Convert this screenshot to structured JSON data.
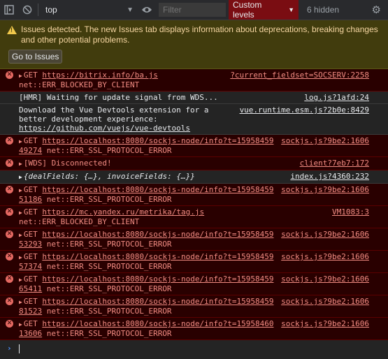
{
  "toolbar": {
    "context": "top",
    "filter_placeholder": "Filter",
    "levels_label": "Custom levels",
    "hidden_count": "6 hidden"
  },
  "warning": {
    "text": "Issues detected. The new Issues tab displays information about deprecations, breaking changes and other potential problems.",
    "button": "Go to Issues"
  },
  "rows": [
    {
      "type": "error",
      "line1": "GET ",
      "url": "https://bitrix.info/ba.js",
      "line2": "net::ERR_BLOCKED_BY_CLIENT",
      "src": "?current_fieldset=SOCSERV:2258"
    },
    {
      "type": "plain",
      "text": "[HMR] Waiting for update signal from WDS...",
      "src": "log.js?1afd:24"
    },
    {
      "type": "plain",
      "text": "Download the Vue Devtools extension for a",
      "text2": "better development experience:",
      "link": "https://github.com/vuejs/vue-devtools",
      "src": "vue.runtime.esm.js?2b0e:8429"
    },
    {
      "type": "error",
      "line1": "GET ",
      "url": "https://localhost:8080/sockjs-node/info?t=15958459",
      "tail": "49274",
      "line2": " net::ERR_SSL_PROTOCOL_ERROR",
      "src": "sockjs.js?9be2:1606"
    },
    {
      "type": "error",
      "text": "[WDS] Disconnected!",
      "src": "client?7eb7:172"
    },
    {
      "type": "plain",
      "text": "{dealFields: {…}, invoiceFields: {…}}",
      "src": "index.js?4360:232"
    },
    {
      "type": "error",
      "line1": "GET ",
      "url": "https://localhost:8080/sockjs-node/info?t=15958459",
      "tail": "51186",
      "line2": " net::ERR_SSL_PROTOCOL_ERROR",
      "src": "sockjs.js?9be2:1606"
    },
    {
      "type": "error",
      "line1": "GET ",
      "url": "https://mc.yandex.ru/metrika/tag.js",
      "line2": "net::ERR_BLOCKED_BY_CLIENT",
      "src": "VM1083:3"
    },
    {
      "type": "error",
      "line1": "GET ",
      "url": "https://localhost:8080/sockjs-node/info?t=15958459",
      "tail": "53293",
      "line2": " net::ERR_SSL_PROTOCOL_ERROR",
      "src": "sockjs.js?9be2:1606"
    },
    {
      "type": "error",
      "line1": "GET ",
      "url": "https://localhost:8080/sockjs-node/info?t=15958459",
      "tail": "57374",
      "line2": " net::ERR_SSL_PROTOCOL_ERROR",
      "src": "sockjs.js?9be2:1606"
    },
    {
      "type": "error",
      "line1": "GET ",
      "url": "https://localhost:8080/sockjs-node/info?t=15958459",
      "tail": "65411",
      "line2": " net::ERR_SSL_PROTOCOL_ERROR",
      "src": "sockjs.js?9be2:1606"
    },
    {
      "type": "error",
      "line1": "GET ",
      "url": "https://localhost:8080/sockjs-node/info?t=15958459",
      "tail": "81523",
      "line2": " net::ERR_SSL_PROTOCOL_ERROR",
      "src": "sockjs.js?9be2:1606"
    },
    {
      "type": "error",
      "line1": "GET ",
      "url": "https://localhost:8080/sockjs-node/info?t=15958460",
      "tail": "13606",
      "line2": " net::ERR_SSL_PROTOCOL_ERROR",
      "src": "sockjs.js?9be2:1606"
    }
  ],
  "colors": {
    "error_bg": "#290000",
    "error_text": "#f28b82",
    "levels_bg": "#7a0d12",
    "warning_bg": "#413c0d"
  }
}
